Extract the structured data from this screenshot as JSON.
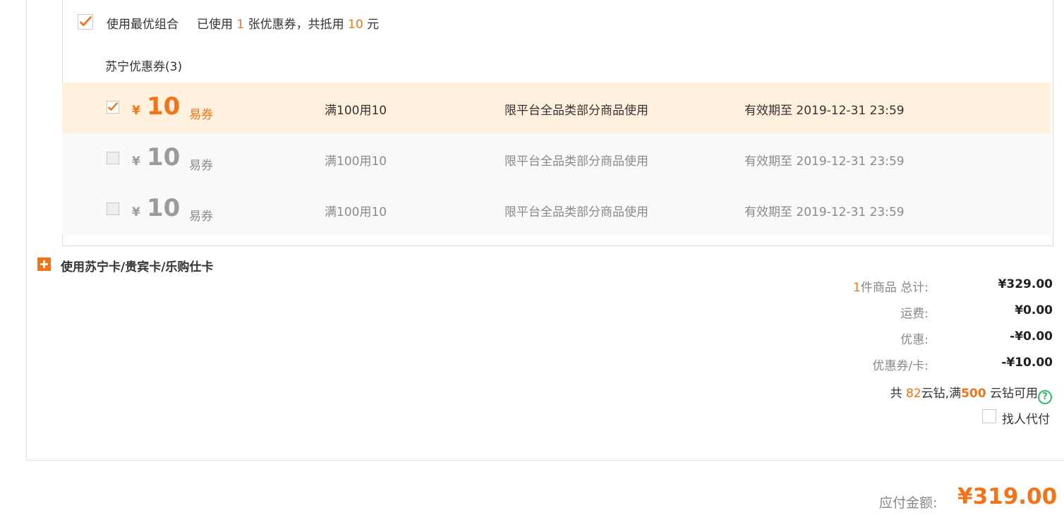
{
  "best_combo": {
    "label": "使用最优组合",
    "used_prefix": "已使用",
    "used_count": "1",
    "used_mid": "张优惠券，共抵用",
    "deduct_amount": "10",
    "currency_unit": "元",
    "checked": true
  },
  "coupon_section": {
    "title": "苏宁优惠券(3)",
    "coupons": [
      {
        "checked": true,
        "enabled": true,
        "symbol": "¥",
        "amount": "10",
        "type": "易券",
        "condition": "满100用10",
        "scope": "限平台全品类部分商品使用",
        "validity": "有效期至 2019-12-31 23:59"
      },
      {
        "checked": false,
        "enabled": false,
        "symbol": "¥",
        "amount": "10",
        "type": "易券",
        "condition": "满100用10",
        "scope": "限平台全品类部分商品使用",
        "validity": "有效期至 2019-12-31 23:59"
      },
      {
        "checked": false,
        "enabled": false,
        "symbol": "¥",
        "amount": "10",
        "type": "易券",
        "condition": "满100用10",
        "scope": "限平台全品类部分商品使用",
        "validity": "有效期至 2019-12-31 23:59"
      }
    ]
  },
  "cards": {
    "label": "使用苏宁卡/贵宾卡/乐购仕卡"
  },
  "summary": {
    "items_count": "1",
    "items_label": "件商品 总计:",
    "total": "¥329.00",
    "shipping_label": "运费:",
    "shipping": "¥0.00",
    "discount_label": "优惠:",
    "discount": "-¥0.00",
    "coupon_label": "优惠券/卡:",
    "coupon": "-¥10.00"
  },
  "points": {
    "prefix": "共",
    "count": "82",
    "mid": "云钻,满",
    "threshold": "500",
    "suffix": "云钻可用",
    "help_icon": "?"
  },
  "proxy_pay": {
    "label": "找人代付",
    "checked": false
  },
  "payable": {
    "label": "应付金额:",
    "amount": "¥319.00"
  },
  "colors": {
    "accent": "#f57216",
    "selected_row_bg": "#fff1de",
    "help_green": "#2fbf62"
  }
}
